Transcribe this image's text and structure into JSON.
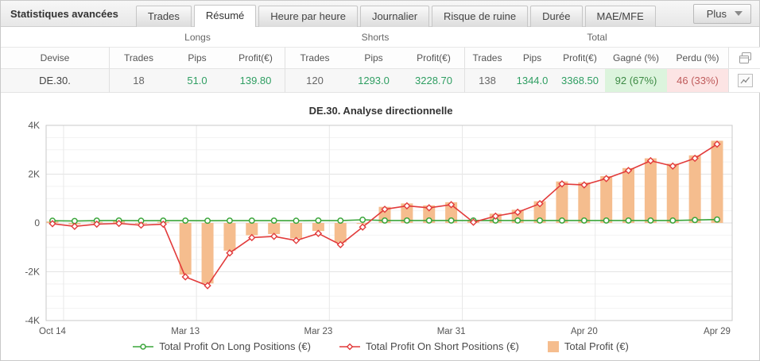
{
  "header": {
    "title": "Statistiques avancées",
    "tabs": [
      {
        "label": "Trades",
        "active": false
      },
      {
        "label": "Résumé",
        "active": true
      },
      {
        "label": "Heure par heure",
        "active": false
      },
      {
        "label": "Journalier",
        "active": false
      },
      {
        "label": "Risque de ruine",
        "active": false
      },
      {
        "label": "Durée",
        "active": false
      },
      {
        "label": "MAE/MFE",
        "active": false
      }
    ],
    "more_button": "Plus",
    "more_button_icon": "caret-down-icon"
  },
  "table": {
    "group_headers": [
      "Longs",
      "Shorts",
      "Total"
    ],
    "columns": {
      "devise": "Devise",
      "trades": "Trades",
      "pips": "Pips",
      "profit": "Profit(€)",
      "gagne": "Gagné (%)",
      "perdu": "Perdu (%)"
    },
    "header_icon": "copy-pages-icon",
    "row": {
      "devise": "DE.30.",
      "longs": {
        "trades": "18",
        "pips": "51.0",
        "profit": "139.80"
      },
      "shorts": {
        "trades": "120",
        "pips": "1293.0",
        "profit": "3228.70"
      },
      "total": {
        "trades": "138",
        "pips": "1344.0",
        "profit": "3368.50"
      },
      "gagne": "92 (67%)",
      "perdu": "46 (33%)",
      "row_icon": "mini-chart-icon"
    },
    "colors": {
      "value_green": "#2f9e62",
      "gagne_bg": "#dcf4dd",
      "gagne_text": "#3c8a44",
      "perdu_bg": "#fce4e4",
      "perdu_text": "#bf5b5b"
    }
  },
  "chart_data": {
    "type": "line",
    "title": "DE.30. Analyse directionnelle",
    "xlabel": "",
    "ylabel": "",
    "ylim": [
      -4000,
      4000
    ],
    "y_ticks": [
      {
        "v": 4000,
        "label": "4K"
      },
      {
        "v": 2000,
        "label": "2K"
      },
      {
        "v": 0,
        "label": "0"
      },
      {
        "v": -2000,
        "label": "-2K"
      },
      {
        "v": -4000,
        "label": "-4K"
      }
    ],
    "y_minor_step": 500,
    "grid": true,
    "legend_position": "bottom",
    "n_points": 31,
    "x_tick_indices": [
      0,
      6,
      12,
      18,
      24,
      30
    ],
    "x_tick_labels": [
      "Oct 14",
      "Mar 13",
      "Mar 23",
      "Mar 31",
      "Apr 20",
      "Apr 29"
    ],
    "series": [
      {
        "name": "Total Profit On Long Positions (€)",
        "type": "line",
        "marker": "circle",
        "color": "#3aa53a",
        "values": [
          90,
          80,
          95,
          100,
          90,
          95,
          95,
          90,
          95,
          95,
          95,
          90,
          100,
          95,
          130,
          100,
          100,
          100,
          100,
          100,
          100,
          100,
          100,
          100,
          100,
          100,
          100,
          100,
          100,
          120,
          139.8
        ]
      },
      {
        "name": "Total Profit On Short Positions (€)",
        "type": "line",
        "marker": "diamond",
        "color": "#e23b3b",
        "values": [
          -30,
          -140,
          -50,
          -20,
          -90,
          -50,
          -2210,
          -2570,
          -1230,
          -600,
          -550,
          -720,
          -430,
          -890,
          -170,
          560,
          700,
          620,
          750,
          30,
          280,
          440,
          790,
          1600,
          1560,
          1820,
          2150,
          2550,
          2330,
          2650,
          3228.7
        ]
      },
      {
        "name": "Total Profit (€)",
        "type": "bar",
        "marker": "square",
        "color": "#f5bd8e",
        "values": [
          60,
          -60,
          45,
          80,
          0,
          45,
          -2115,
          -2480,
          -1135,
          -505,
          -455,
          -630,
          -330,
          -795,
          -40,
          660,
          800,
          720,
          850,
          130,
          380,
          540,
          890,
          1700,
          1660,
          1920,
          2250,
          2650,
          2430,
          2770,
          3368.5
        ]
      }
    ]
  }
}
